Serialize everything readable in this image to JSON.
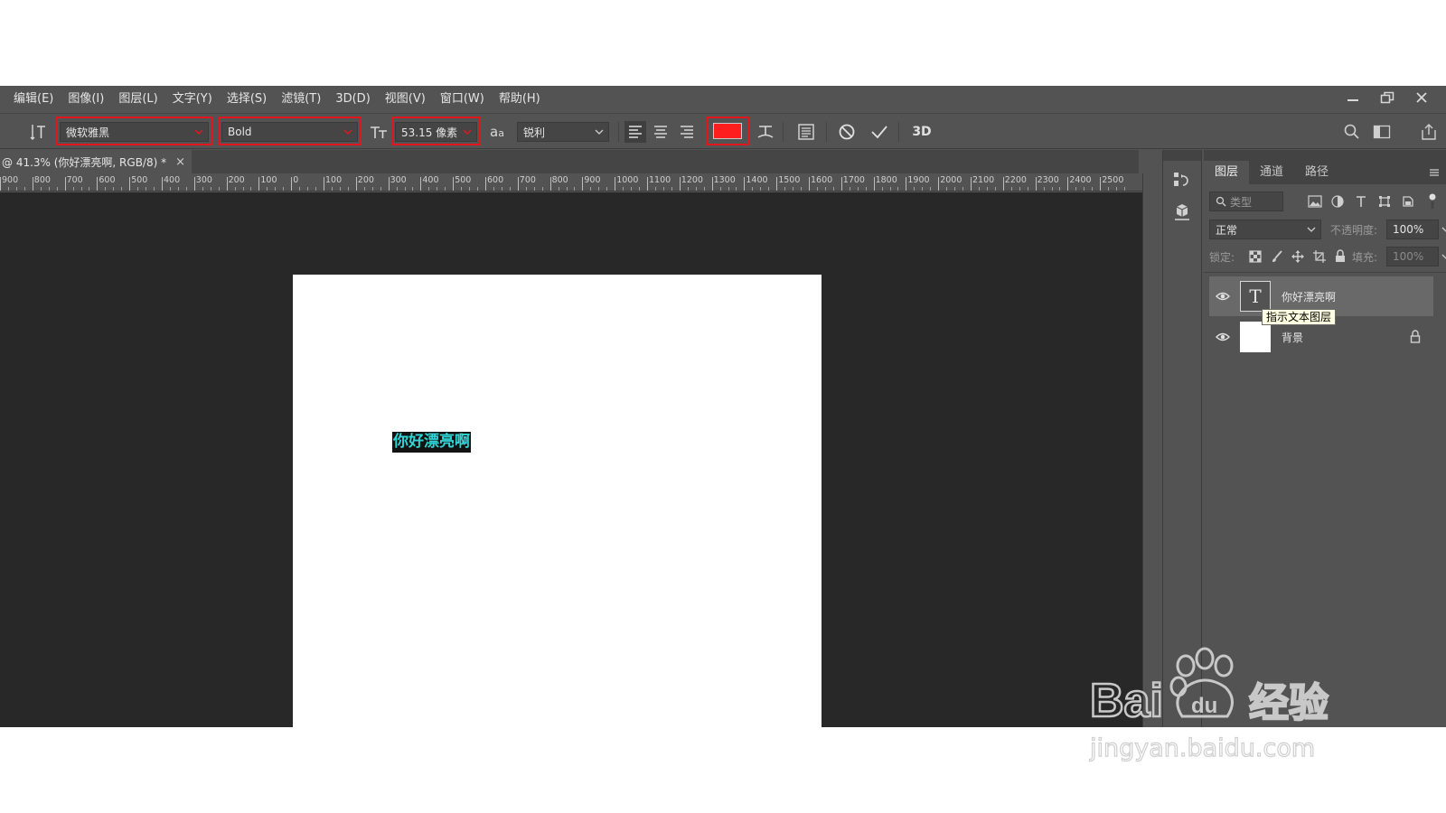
{
  "menu": [
    "编辑(E)",
    "图像(I)",
    "图层(L)",
    "文字(Y)",
    "选择(S)",
    "滤镜(T)",
    "3D(D)",
    "视图(V)",
    "窗口(W)",
    "帮助(H)"
  ],
  "options": {
    "font_family": "微软雅黑",
    "font_style": "Bold",
    "font_size": "53.15 像素",
    "aa_glyph": "a",
    "aa_glyph_small": "a",
    "antialias": "锐利",
    "warp_text_label": "3D",
    "color_swatch": "#ff1e1e",
    "highlight_color": "#e0181e"
  },
  "doc_tab": {
    "title": "@ 41.3% (你好漂亮啊, RGB/8) *",
    "close": "×"
  },
  "ruler_labels": [
    "900",
    "800",
    "700",
    "600",
    "500",
    "400",
    "300",
    "200",
    "100",
    "0",
    "100",
    "200",
    "300",
    "400",
    "500",
    "600",
    "700",
    "800",
    "900",
    "1000",
    "1100",
    "1200",
    "1300",
    "1400",
    "1500",
    "1600",
    "1700",
    "1800",
    "1900",
    "2000",
    "2100",
    "2200",
    "2300",
    "2400",
    "2500"
  ],
  "canvas": {
    "text": "你好漂亮啊",
    "text_color": "#2fd6d6"
  },
  "layers_panel": {
    "tabs": [
      "图层",
      "通道",
      "路径"
    ],
    "filter_placeholder": "类型",
    "blend_mode": "正常",
    "opacity_label": "不透明度:",
    "opacity_value": "100%",
    "lock_label": "锁定:",
    "fill_label": "填充:",
    "fill_value": "100%",
    "layers": [
      {
        "name": "你好漂亮啊",
        "type_glyph": "T",
        "selected": true
      },
      {
        "name": "背景",
        "selected": false
      }
    ],
    "tooltip": "指示文本图层"
  },
  "watermark": {
    "brand_latin": "Bai",
    "brand_du": "du",
    "brand_cn": "经验",
    "url": "jingyan.baidu.com"
  }
}
